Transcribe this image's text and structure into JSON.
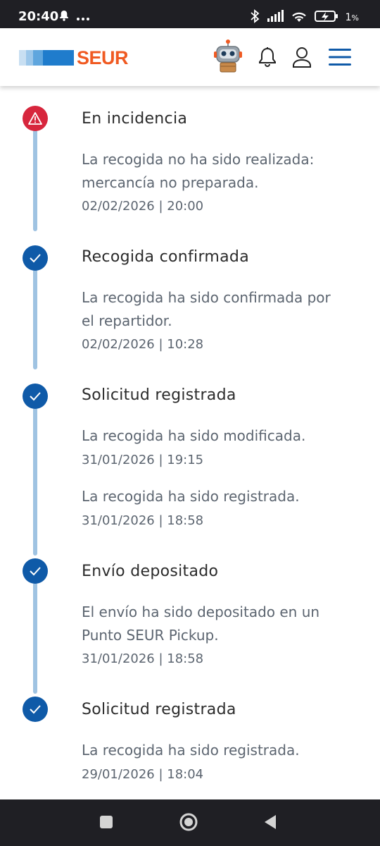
{
  "status_bar": {
    "time": "20:40",
    "battery": "1",
    "battery_unit": "%",
    "icons": [
      "notification-bell-icon",
      "more-dots-icon",
      "bluetooth-icon",
      "signal-icon",
      "wifi-icon",
      "battery-charging-icon"
    ]
  },
  "header": {
    "logo_text": "SEUR",
    "brand_color": "#f05a22",
    "accent_color": "#0f5aa8",
    "icons": [
      "robot-assistant-icon",
      "bell-icon",
      "user-icon",
      "menu-icon"
    ]
  },
  "events": [
    {
      "status": "error",
      "title": "En incidencia",
      "descriptions": [
        {
          "lines": [
            "La recogida no ha sido realizada:",
            "mercancía no preparada."
          ],
          "date": "02/02/2026 | 20:00"
        }
      ]
    },
    {
      "status": "done",
      "title": "Recogida confirmada",
      "descriptions": [
        {
          "lines": [
            "La recogida ha sido confirmada por",
            "el repartidor."
          ],
          "date": "02/02/2026 | 10:28"
        }
      ]
    },
    {
      "status": "done",
      "title": "Solicitud registrada",
      "descriptions": [
        {
          "lines": [
            "La recogida ha sido modificada."
          ],
          "date": "31/01/2026 | 19:15"
        },
        {
          "lines": [
            "La recogida ha sido registrada."
          ],
          "date": "31/01/2026 | 18:58"
        }
      ]
    },
    {
      "status": "done",
      "title": "Envío depositado",
      "descriptions": [
        {
          "lines": [
            "El envío ha sido depositado en un",
            "Punto SEUR Pickup."
          ],
          "date": "31/01/2026 | 18:58"
        }
      ]
    },
    {
      "status": "done",
      "title": "Solicitud registrada",
      "descriptions": [
        {
          "lines": [
            "La recogida ha sido registrada."
          ],
          "date": "29/01/2026 | 18:04"
        }
      ]
    }
  ],
  "nav_bar": {
    "icons": [
      "recents-square-icon",
      "home-circle-icon",
      "back-triangle-icon"
    ]
  }
}
